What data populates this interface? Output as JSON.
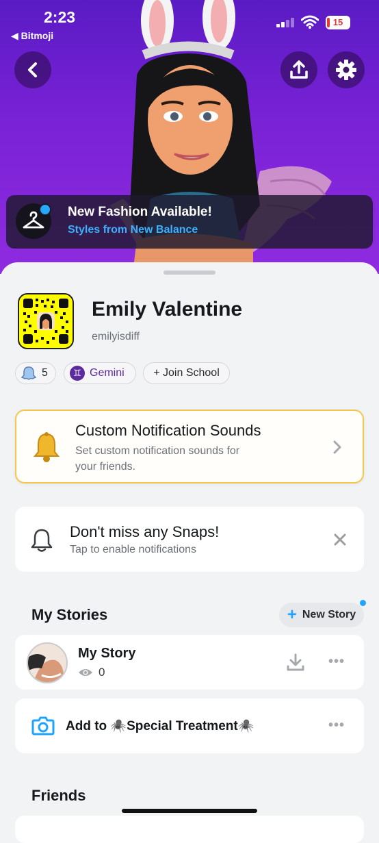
{
  "status_bar": {
    "time": "2:23",
    "back_app": "◀ Bitmoji",
    "battery": "15"
  },
  "banner": {
    "title": "New Fashion Available!",
    "subtitle": "Styles from New Balance"
  },
  "profile": {
    "display_name": "Emily Valentine",
    "username": "emilyisdiff",
    "pills": {
      "friend_count": "5",
      "zodiac": "Gemini",
      "school": "+ Join School"
    }
  },
  "notification_sounds_card": {
    "title": "Custom Notification Sounds",
    "subtitle": "Set custom notification sounds for your friends.",
    "subtitle_line1": "Set custom notification sounds for",
    "subtitle_line2": "your friends."
  },
  "snaps_card": {
    "title": "Don't miss any Snaps!",
    "subtitle": "Tap to enable notifications"
  },
  "my_stories": {
    "heading": "My Stories",
    "new_story_label": "New Story",
    "story": {
      "title": "My Story",
      "views": "0"
    },
    "add_to_label": "Add to 🕷️Special Treatment🕷️"
  },
  "friends": {
    "heading": "Friends"
  },
  "colors": {
    "hero_purple": "#7a22d6",
    "snap_yellow": "#fffc00",
    "link_blue": "#3db0ff",
    "accent_blue": "#1ea3ff"
  }
}
